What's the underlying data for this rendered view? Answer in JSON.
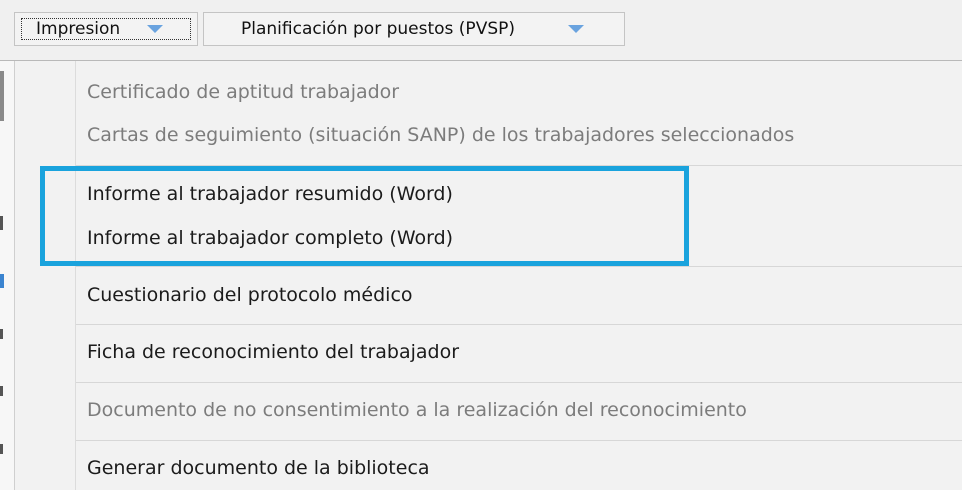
{
  "toolbar": {
    "impresion_label": "Impresion",
    "planificacion_label": "Planificación por puestos (PVSP)",
    "dropdown_icon": "chevron-down-icon",
    "dropdown_color": "#6aa3df"
  },
  "menu": {
    "items": [
      {
        "label": "Certificado de aptitud trabajador",
        "enabled": false
      },
      {
        "label": "Cartas de seguimiento (situación SANP) de los trabajadores seleccionados",
        "enabled": false
      },
      {
        "label": "Informe al trabajador resumido (Word)",
        "enabled": true
      },
      {
        "label": "Informe al trabajador completo (Word)",
        "enabled": true
      },
      {
        "label": "Cuestionario del protocolo médico",
        "enabled": true
      },
      {
        "label": "Ficha de reconocimiento del trabajador",
        "enabled": true
      },
      {
        "label": "Documento de no consentimiento a la realización del reconocimiento",
        "enabled": false
      },
      {
        "label": "Generar documento de la biblioteca",
        "enabled": true
      }
    ],
    "highlight_color": "#1aa3dd"
  }
}
